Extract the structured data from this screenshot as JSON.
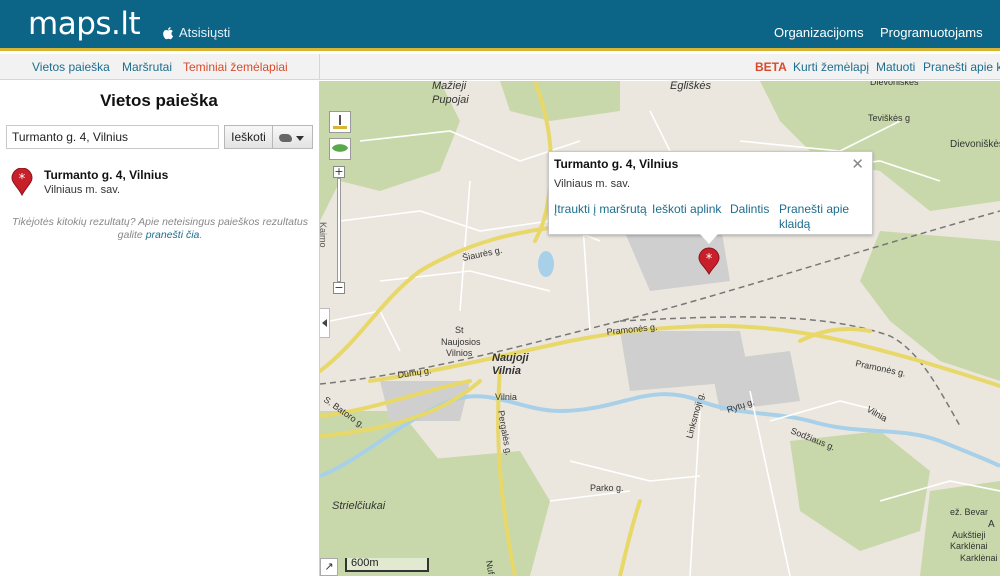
{
  "header": {
    "logo": "maps.lt",
    "download_label": "Atsisiųsti",
    "nav": [
      "Organizacijoms",
      "Programuotojams"
    ]
  },
  "subbar": {
    "left_links": [
      "Vietos paieška",
      "Maršrutai",
      "Teminiai žemėlapiai"
    ],
    "active_link": "Teminiai žemėlapiai",
    "badge": "BETA",
    "right_links": [
      "Kurti žemėlapį",
      "Matuoti",
      "Pranešti apie k"
    ]
  },
  "panel": {
    "title": "Vietos paieška",
    "search_value": "Turmanto g. 4, Vilnius",
    "search_button": "Ieškoti",
    "result": {
      "title": "Turmanto g. 4, Vilnius",
      "subtitle": "Vilniaus m. sav."
    },
    "note_text": "Tikėjotės kitokių rezultatų? Apie neteisingus paieškos rezultatus galite",
    "note_link": "pranešti čia",
    "note_end": "."
  },
  "popup": {
    "title": "Turmanto g. 4, Vilnius",
    "subtitle": "Vilniaus m. sav.",
    "actions": [
      "Įtraukti į maršrutą",
      "Ieškoti aplink",
      "Dalintis",
      "Pranešti apie klaidą"
    ]
  },
  "map": {
    "zoom_label": "Kaimo",
    "scale_label": "600m",
    "place_labels": [
      "Mažieji Pupojai",
      "Eglīškės",
      "Dievoniškės",
      "Teviškės g",
      "Dievoniškės",
      "Šiaurės g.",
      "St Naujosios Vilnios",
      "Naujoji Vilnia",
      "Pramonės g.",
      "Pramonės g.",
      "Dūmų g.",
      "Vilnia",
      "S. Batoro g.",
      "Pergalės g.",
      "Linksmoji g.",
      "Rytų g.",
      "Sodžiaus g.",
      "Vilnia",
      "Parko g.",
      "Strielčiukai",
      "ež. Bevar",
      "Aukštieji Karklėnai",
      "Karklėnai",
      "Nuf",
      "A"
    ]
  },
  "colors": {
    "header": "#0c6587",
    "header_accent": "#d9b536",
    "link": "#1e6d8d",
    "active": "#d84b2b",
    "marker": "#c8202b"
  }
}
